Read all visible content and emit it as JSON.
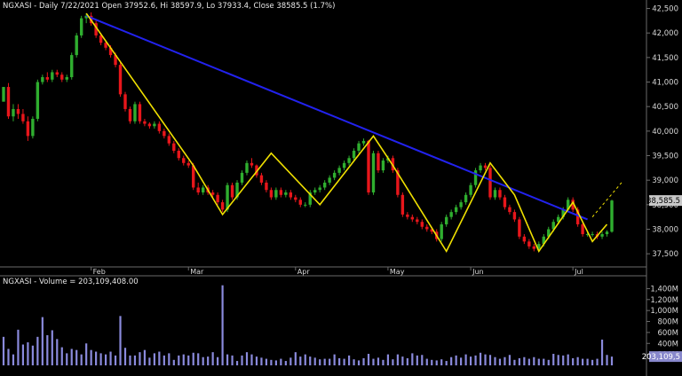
{
  "header": {
    "main_title": "NGXASI - Daily 7/22/2021 Open 37952.6, Hi 38597.9, Lo 37933.4, Close 38585.5 (1.7%)",
    "volume_title": "NGXASI - Volume = 203,109,408.00"
  },
  "colors": {
    "up": "#2fae2f",
    "down": "#e8161b",
    "trendline": "#2222ee",
    "zigzag": "#f0e000",
    "volume": "#8a8adc",
    "last_price_label_bg": "#c8c8c8",
    "volume_label_bg": "#8888cc",
    "axis_text": "#d8d8d8",
    "panel_border": "#6a6a6a"
  },
  "chart_data": [
    {
      "type": "candlestick",
      "ylim": [
        37250,
        42600
      ],
      "y_axis_side": "right",
      "y_ticks": [
        37500,
        38000,
        38500,
        39000,
        39500,
        40000,
        40500,
        41000,
        41500,
        42000,
        42500
      ],
      "y_tick_labels": [
        "37,500",
        "38,000",
        "38,500",
        "39,000",
        "39,500",
        "40,000",
        "40,500",
        "41,000",
        "41,500",
        "42,000",
        "42,500"
      ],
      "x_labels": [
        {
          "label": "Feb",
          "index": 18
        },
        {
          "label": "Mar",
          "index": 38
        },
        {
          "label": "Apr",
          "index": 60
        },
        {
          "label": "May",
          "index": 79
        },
        {
          "label": "Jun",
          "index": 96
        },
        {
          "label": "Jul",
          "index": 117
        }
      ],
      "last_price_label": "38,585.5",
      "last_price": 38585.5,
      "candles": [
        [
          40600,
          40900,
          40600,
          40900
        ],
        [
          40900,
          40980,
          40250,
          40300
        ],
        [
          40300,
          40550,
          40200,
          40450
        ],
        [
          40450,
          40550,
          40250,
          40350
        ],
        [
          40350,
          40450,
          40150,
          40200
        ],
        [
          40200,
          40300,
          39800,
          39900
        ],
        [
          39900,
          40300,
          39850,
          40250
        ],
        [
          40250,
          41050,
          40200,
          41000
        ],
        [
          41000,
          41150,
          40950,
          41100
        ],
        [
          41100,
          41200,
          41000,
          41050
        ],
        [
          41050,
          41250,
          41000,
          41200
        ],
        [
          41200,
          41250,
          41100,
          41150
        ],
        [
          41150,
          41200,
          41000,
          41050
        ],
        [
          41050,
          41150,
          41000,
          41100
        ],
        [
          41100,
          41600,
          41050,
          41550
        ],
        [
          41550,
          42000,
          41500,
          41950
        ],
        [
          41950,
          42350,
          41900,
          42300
        ],
        [
          42300,
          42400,
          42200,
          42350
        ],
        [
          42350,
          42420,
          42150,
          42200
        ],
        [
          42200,
          42250,
          41900,
          41950
        ],
        [
          41950,
          42000,
          41750,
          41800
        ],
        [
          41800,
          41850,
          41650,
          41700
        ],
        [
          41700,
          41750,
          41500,
          41550
        ],
        [
          41550,
          41600,
          41300,
          41350
        ],
        [
          41350,
          41400,
          40700,
          40750
        ],
        [
          40750,
          40800,
          40400,
          40450
        ],
        [
          40450,
          40500,
          40150,
          40200
        ],
        [
          40200,
          40600,
          40150,
          40550
        ],
        [
          40550,
          40600,
          40150,
          40200
        ],
        [
          40200,
          40250,
          40100,
          40150
        ],
        [
          40150,
          40180,
          40050,
          40100
        ],
        [
          40100,
          40200,
          40050,
          40150
        ],
        [
          40150,
          40200,
          39950,
          40000
        ],
        [
          40000,
          40050,
          39850,
          39900
        ],
        [
          39900,
          39950,
          39700,
          39750
        ],
        [
          39750,
          39800,
          39550,
          39600
        ],
        [
          39600,
          39650,
          39400,
          39450
        ],
        [
          39450,
          39500,
          39300,
          39350
        ],
        [
          39350,
          39400,
          39250,
          39300
        ],
        [
          39300,
          39350,
          38800,
          38850
        ],
        [
          38850,
          38950,
          38700,
          38750
        ],
        [
          38750,
          38900,
          38700,
          38850
        ],
        [
          38850,
          38900,
          38700,
          38750
        ],
        [
          38750,
          38800,
          38650,
          38700
        ],
        [
          38700,
          38750,
          38500,
          38550
        ],
        [
          38550,
          38600,
          38350,
          38400
        ],
        [
          38400,
          38950,
          38350,
          38900
        ],
        [
          38900,
          38950,
          38600,
          38650
        ],
        [
          38650,
          39000,
          38600,
          38950
        ],
        [
          38950,
          39200,
          38900,
          39150
        ],
        [
          39150,
          39400,
          39100,
          39350
        ],
        [
          39350,
          39450,
          39250,
          39300
        ],
        [
          39300,
          39320,
          39050,
          39100
        ],
        [
          39100,
          39150,
          38900,
          38950
        ],
        [
          38950,
          39000,
          38750,
          38800
        ],
        [
          38800,
          38850,
          38600,
          38650
        ],
        [
          38650,
          38850,
          38600,
          38800
        ],
        [
          38800,
          38850,
          38650,
          38700
        ],
        [
          38700,
          38800,
          38650,
          38750
        ],
        [
          38750,
          38800,
          38600,
          38650
        ],
        [
          38650,
          38700,
          38550,
          38600
        ],
        [
          38600,
          38650,
          38450,
          38500
        ],
        [
          38500,
          38550,
          38450,
          38500
        ],
        [
          38500,
          38800,
          38450,
          38750
        ],
        [
          38750,
          38850,
          38700,
          38800
        ],
        [
          38800,
          38900,
          38750,
          38850
        ],
        [
          38850,
          39000,
          38800,
          38950
        ],
        [
          38950,
          39100,
          38900,
          39050
        ],
        [
          39050,
          39200,
          39000,
          39150
        ],
        [
          39150,
          39300,
          39100,
          39250
        ],
        [
          39250,
          39400,
          39200,
          39350
        ],
        [
          39350,
          39500,
          39300,
          39450
        ],
        [
          39450,
          39650,
          39400,
          39600
        ],
        [
          39600,
          39800,
          39550,
          39750
        ],
        [
          39750,
          39850,
          39700,
          39800
        ],
        [
          39800,
          39820,
          38700,
          38750
        ],
        [
          38750,
          39600,
          38700,
          39550
        ],
        [
          39550,
          39600,
          39150,
          39200
        ],
        [
          39200,
          39450,
          39150,
          39400
        ],
        [
          39400,
          39500,
          39350,
          39450
        ],
        [
          39450,
          39500,
          39150,
          39200
        ],
        [
          39200,
          39250,
          38650,
          38700
        ],
        [
          38700,
          38750,
          38250,
          38300
        ],
        [
          38300,
          38350,
          38200,
          38250
        ],
        [
          38250,
          38300,
          38150,
          38200
        ],
        [
          38200,
          38250,
          38100,
          38150
        ],
        [
          38150,
          38200,
          38000,
          38050
        ],
        [
          38050,
          38100,
          37950,
          38000
        ],
        [
          38000,
          38050,
          37900,
          37950
        ],
        [
          37950,
          38000,
          37750,
          37800
        ],
        [
          37800,
          38150,
          37750,
          38100
        ],
        [
          38100,
          38300,
          38050,
          38250
        ],
        [
          38250,
          38400,
          38200,
          38350
        ],
        [
          38350,
          38500,
          38300,
          38450
        ],
        [
          38450,
          38600,
          38400,
          38550
        ],
        [
          38550,
          38750,
          38500,
          38700
        ],
        [
          38700,
          38950,
          38650,
          38900
        ],
        [
          38900,
          39250,
          38850,
          39200
        ],
        [
          39200,
          39350,
          39150,
          39300
        ],
        [
          39300,
          39350,
          39200,
          39250
        ],
        [
          39250,
          39300,
          38600,
          38650
        ],
        [
          38650,
          38850,
          38600,
          38800
        ],
        [
          38800,
          38850,
          38600,
          38650
        ],
        [
          38650,
          38700,
          38400,
          38450
        ],
        [
          38450,
          38500,
          38300,
          38350
        ],
        [
          38350,
          38400,
          38150,
          38200
        ],
        [
          38200,
          38250,
          37800,
          37850
        ],
        [
          37850,
          37900,
          37700,
          37750
        ],
        [
          37750,
          37800,
          37600,
          37650
        ],
        [
          37650,
          37700,
          37550,
          37600
        ],
        [
          37600,
          37750,
          37550,
          37700
        ],
        [
          37700,
          37900,
          37650,
          37850
        ],
        [
          37850,
          38050,
          37800,
          38000
        ],
        [
          38000,
          38200,
          37950,
          38150
        ],
        [
          38150,
          38300,
          38100,
          38250
        ],
        [
          38250,
          38450,
          38200,
          38400
        ],
        [
          38400,
          38650,
          38350,
          38600
        ],
        [
          38600,
          38650,
          38350,
          38400
        ],
        [
          38400,
          38450,
          38050,
          38100
        ],
        [
          38100,
          38150,
          37850,
          37900
        ],
        [
          37900,
          37950,
          37850,
          37900
        ],
        [
          37900,
          37950,
          37850,
          37900
        ],
        [
          37900,
          37950,
          37800,
          37850
        ],
        [
          37850,
          37950,
          37800,
          37900
        ],
        [
          37900,
          37980,
          37850,
          37950
        ],
        [
          37950,
          38600,
          37930,
          38585
        ]
      ],
      "trendline": [
        [
          17,
          42350
        ],
        [
          120,
          38200
        ]
      ],
      "trendline_extension": [
        [
          121,
          38250
        ],
        [
          127,
          38950
        ]
      ],
      "zigzag": [
        [
          17,
          42400
        ],
        [
          39,
          39300
        ],
        [
          45,
          38300
        ],
        [
          55,
          39550
        ],
        [
          65,
          38500
        ],
        [
          76,
          39900
        ],
        [
          80,
          39300
        ],
        [
          91,
          37550
        ],
        [
          100,
          39350
        ],
        [
          105,
          38700
        ],
        [
          110,
          37550
        ],
        [
          117,
          38550
        ],
        [
          121,
          37750
        ],
        [
          124,
          38100
        ]
      ]
    },
    {
      "type": "bar",
      "series_label": "Volume",
      "ylim": [
        0,
        1520000000
      ],
      "y_ticks": [
        200000000,
        400000000,
        600000000,
        800000000,
        1000000000,
        1200000000,
        1400000000
      ],
      "y_tick_labels": [
        "200M",
        "400M",
        "600M",
        "800M",
        "1,000M",
        "1,200M",
        "1,400M"
      ],
      "last_volume_label": "203,109,5",
      "values": [
        520000000,
        300000000,
        200000000,
        650000000,
        380000000,
        420000000,
        360000000,
        520000000,
        880000000,
        550000000,
        640000000,
        480000000,
        330000000,
        220000000,
        300000000,
        280000000,
        200000000,
        400000000,
        280000000,
        250000000,
        220000000,
        200000000,
        250000000,
        180000000,
        900000000,
        320000000,
        180000000,
        180000000,
        240000000,
        280000000,
        140000000,
        220000000,
        250000000,
        180000000,
        220000000,
        100000000,
        180000000,
        200000000,
        180000000,
        230000000,
        220000000,
        150000000,
        160000000,
        240000000,
        150000000,
        1460000000,
        200000000,
        180000000,
        80000000,
        180000000,
        240000000,
        200000000,
        160000000,
        140000000,
        120000000,
        100000000,
        90000000,
        120000000,
        80000000,
        140000000,
        240000000,
        160000000,
        200000000,
        160000000,
        140000000,
        110000000,
        120000000,
        120000000,
        200000000,
        130000000,
        120000000,
        180000000,
        110000000,
        90000000,
        130000000,
        210000000,
        120000000,
        140000000,
        100000000,
        200000000,
        110000000,
        200000000,
        160000000,
        130000000,
        220000000,
        180000000,
        190000000,
        120000000,
        100000000,
        90000000,
        110000000,
        80000000,
        150000000,
        180000000,
        140000000,
        200000000,
        160000000,
        180000000,
        230000000,
        200000000,
        190000000,
        150000000,
        120000000,
        150000000,
        190000000,
        100000000,
        130000000,
        150000000,
        120000000,
        150000000,
        120000000,
        120000000,
        100000000,
        210000000,
        190000000,
        180000000,
        200000000,
        130000000,
        150000000,
        120000000,
        120000000,
        100000000,
        120000000,
        470000000,
        190000000,
        160000000
      ]
    }
  ]
}
